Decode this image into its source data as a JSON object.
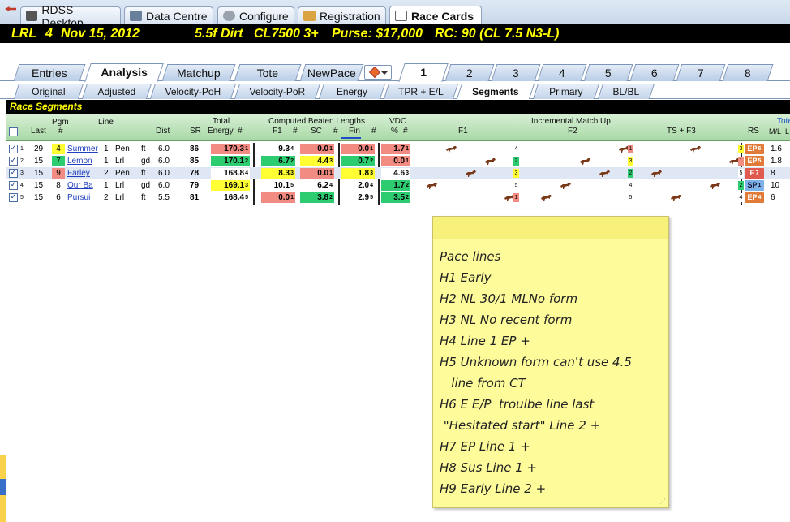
{
  "app_tabs": [
    {
      "label": "RDSS Desktop",
      "icon": "horse-icon"
    },
    {
      "label": "Data Centre",
      "icon": "database-icon"
    },
    {
      "label": "Configure",
      "icon": "gear-icon"
    },
    {
      "label": "Registration",
      "icon": "registration-icon"
    },
    {
      "label": "Race Cards",
      "icon": "document-icon"
    }
  ],
  "race_header": {
    "track": "LRL",
    "race_no": "4",
    "date": "Nov 15, 2012",
    "distance_surface": "5.5f  Dirt",
    "class": "CL7500  3+",
    "purse": "Purse: $17,000",
    "rc": "RC: 90  (CL 7.5 N3-L)"
  },
  "analysis_tabs": [
    "Entries",
    "Analysis",
    "Matchup",
    "Tote",
    "NewPace"
  ],
  "race_number_tabs": [
    "1",
    "2",
    "3",
    "4",
    "5",
    "6",
    "7",
    "8"
  ],
  "view_tabs": [
    "Original",
    "Adjusted",
    "Velocity-PoH",
    "Velocity-PoR",
    "Energy",
    "TPR + E/L",
    "Segments",
    "Primary",
    "BL/BL"
  ],
  "section_title": "Race Segments",
  "headers": {
    "pgm": "Pgm",
    "pgm_hash": "#",
    "last": "Last",
    "line": "Line",
    "dist": "Dist",
    "sr": "SR",
    "total": "Total",
    "energy": "Energy",
    "energy_hash": "#",
    "cbl": "Computed Beaten Lengths",
    "f1": "F1",
    "f1_hash": "#",
    "sc": "SC",
    "sc_hash": "#",
    "fin": "Fin",
    "fin_hash": "#",
    "vdc": "VDC",
    "vdc_pct": "%",
    "vdc_hash": "#",
    "incremental": "Incremental Match Up",
    "inc_f1": "F1",
    "inc_f2": "F2",
    "inc_ts": "TS + F3",
    "rs": "RS",
    "tote": "Tote",
    "ml": "M/L",
    "l": "L"
  },
  "rows": [
    {
      "idx": "1",
      "last": "29",
      "pgm": "4",
      "horse": "Summer",
      "line": "1",
      "track": "Pen",
      "cond": "ft",
      "dist": "6.0",
      "sr": "86",
      "energy": "170.3",
      "energy_rank": "1",
      "f1": "9.3",
      "f1_rank": "4",
      "sc": "0.0",
      "sc_rank": "1",
      "fin": "0.0",
      "fin_rank": "1",
      "vdc": "1.7",
      "vdc_rank": "1",
      "inc_f1": "4",
      "inc_f2": "1",
      "inc_ts": "3",
      "rs": "EP",
      "rs_rank": "6",
      "ml": "1.6"
    },
    {
      "idx": "2",
      "last": "15",
      "pgm": "7",
      "horse": "Lemon",
      "line": "1",
      "track": "Lrl",
      "cond": "gd",
      "dist": "6.0",
      "sr": "85",
      "energy": "170.1",
      "energy_rank": "2",
      "f1": "6.7",
      "f1_rank": "2",
      "sc": "4.4",
      "sc_rank": "3",
      "fin": "0.7",
      "fin_rank": "2",
      "vdc": "0.0",
      "vdc_rank": "1",
      "inc_f1": "2",
      "inc_f2": "3",
      "inc_ts": "1",
      "rs": "EP",
      "rs_rank": "5",
      "ml": "1.8"
    },
    {
      "idx": "3",
      "last": "15",
      "pgm": "9",
      "horse": "Farley",
      "line": "2",
      "track": "Pen",
      "cond": "ft",
      "dist": "6.0",
      "sr": "78",
      "energy": "168.8",
      "energy_rank": "4",
      "f1": "8.3",
      "f1_rank": "3",
      "sc": "0.0",
      "sc_rank": "1",
      "fin": "1.8",
      "fin_rank": "3",
      "vdc": "4.6",
      "vdc_rank": "3",
      "inc_f1": "3",
      "inc_f2": "2",
      "inc_ts": "5",
      "rs": "E",
      "rs_rank": "7",
      "ml": "8"
    },
    {
      "idx": "4",
      "last": "15",
      "pgm": "8",
      "horse": "Our Ba",
      "line": "1",
      "track": "Lrl",
      "cond": "gd",
      "dist": "6.0",
      "sr": "79",
      "energy": "169.1",
      "energy_rank": "3",
      "f1": "10.1",
      "f1_rank": "5",
      "sc": "6.2",
      "sc_rank": "4",
      "fin": "2.0",
      "fin_rank": "4",
      "vdc": "1.7",
      "vdc_rank": "2",
      "inc_f1": "5",
      "inc_f2": "4",
      "inc_ts": "2",
      "rs": "SP",
      "rs_rank": "1",
      "ml": "10"
    },
    {
      "idx": "5",
      "last": "15",
      "pgm": "6",
      "horse": "Pursui",
      "line": "2",
      "track": "Lrl",
      "cond": "ft",
      "dist": "5.5",
      "sr": "81",
      "energy": "168.4",
      "energy_rank": "5",
      "f1": "0.0",
      "f1_rank": "1",
      "sc": "3.8",
      "sc_rank": "2",
      "fin": "2.9",
      "fin_rank": "5",
      "vdc": "3.5",
      "vdc_rank": "2",
      "inc_f1": "1",
      "inc_f2": "5",
      "inc_ts": "4",
      "rs": "EP",
      "rs_rank": "4",
      "ml": "6"
    }
  ],
  "note_lines": [
    "Pace lines",
    "H1 Early",
    "H2 NL 30/1 MLNo form",
    "H3 NL No recent form",
    "H4 Line 1 EP +",
    "H5 Unknown form can't use 4.5",
    "   line from CT",
    "H6 E E/P  troulbe line last",
    " \"Hesitated start\" Line 2 +",
    "H7 EP Line 1 +",
    "H8 Sus Line 1 +",
    "H9 Early Line 2 +"
  ],
  "colors": {
    "header_yellow": "#ffff00",
    "cell_red": "#f28b82",
    "cell_yellow": "#ffff33",
    "cell_green": "#2ecc71",
    "rs_ep": "#e07b39",
    "rs_e": "#e05a4f",
    "rs_sp": "#7fb2e8",
    "note": "#fdfb9a"
  }
}
